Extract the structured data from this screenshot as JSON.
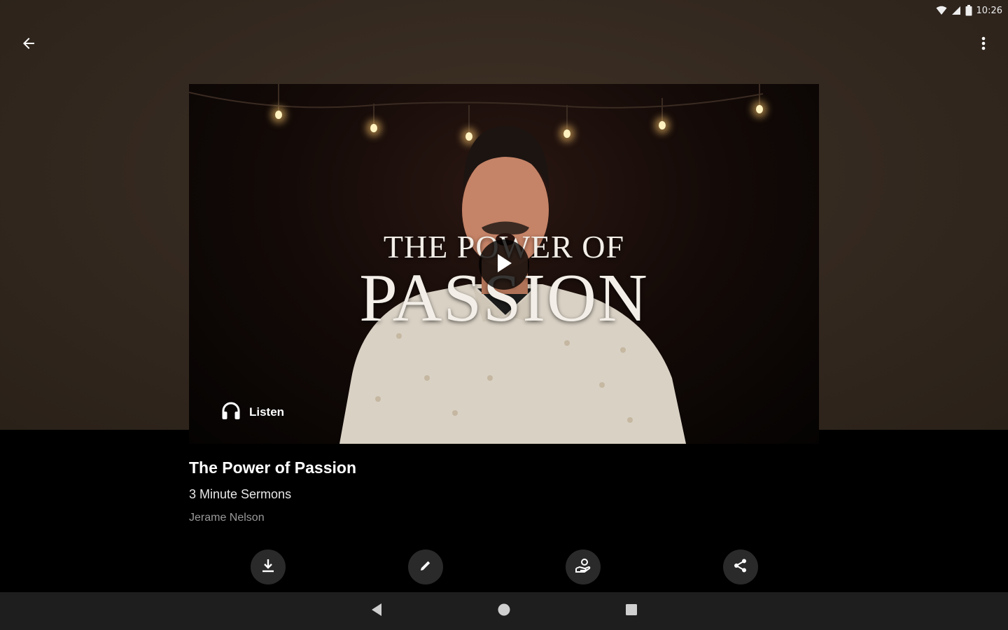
{
  "status_bar": {
    "time": "10:26",
    "icons": [
      "wifi-icon",
      "signal-icon",
      "battery-icon"
    ]
  },
  "toolbar": {
    "back_icon": "arrow-left-icon",
    "more_icon": "more-vertical-icon"
  },
  "video": {
    "thumbnail_title_line1": "THE POWER OF",
    "thumbnail_title_line2": "PASSION",
    "play_icon": "play-icon",
    "listen_label": "Listen",
    "listen_icon": "headphones-icon"
  },
  "sermon": {
    "title": "The Power of Passion",
    "series": "3 Minute Sermons",
    "speaker": "Jerame Nelson"
  },
  "actions": [
    {
      "icon": "download-icon"
    },
    {
      "icon": "pencil-icon"
    },
    {
      "icon": "give-icon"
    },
    {
      "icon": "share-icon"
    }
  ],
  "nav": {
    "back_icon": "triangle-back-icon",
    "home_icon": "circle-home-icon",
    "recents_icon": "square-recents-icon"
  },
  "colors": {
    "top_background": "#33281f",
    "content_background": "#000000",
    "action_button": "#2a2a2a",
    "nav_bar": "#1e1e1e",
    "speaker_text": "#9a9a9a"
  }
}
